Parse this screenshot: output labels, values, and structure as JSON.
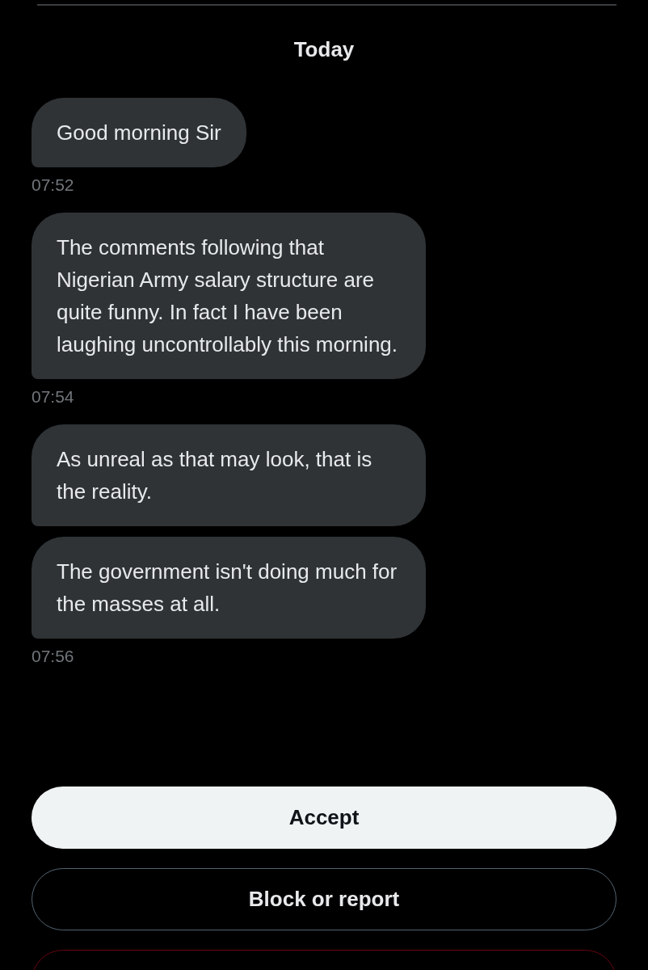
{
  "day_label": "Today",
  "messages": [
    {
      "text": "Good morning Sir",
      "time": "07:52"
    },
    {
      "text": "The comments following that Nigerian Army salary structure are quite funny. In fact I have been laughing uncontrollably this morning.",
      "time": "07:54"
    },
    {
      "text": "As unreal as that may look, that is the reality."
    },
    {
      "text": "The government isn't doing much for the masses at all.",
      "time": "07:56"
    }
  ],
  "actions": [
    {
      "label": "Accept",
      "kind": "primary"
    },
    {
      "label": "Block or report",
      "kind": "outline"
    },
    {
      "kind": "danger"
    }
  ]
}
